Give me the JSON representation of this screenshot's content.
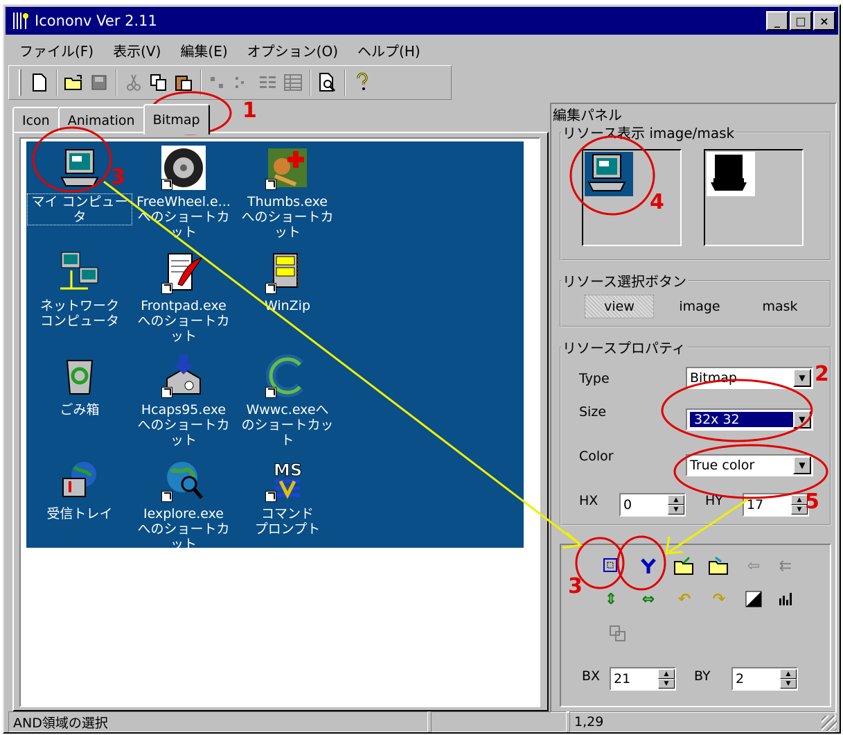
{
  "window": {
    "title": "Icononv Ver 2.11",
    "min": "_",
    "max": "□",
    "close": "×"
  },
  "menu": [
    "ファイル(F)",
    "表示(V)",
    "編集(E)",
    "オプション(O)",
    "ヘルプ(H)"
  ],
  "toolbar": {
    "icons": [
      "new-file-icon",
      "open-folder-icon",
      "save-icon",
      "cut-icon",
      "copy-icon",
      "paste-icon",
      "large-icons-icon",
      "small-icons-icon",
      "list-icon",
      "details-icon",
      "print-preview-icon",
      "help-icon"
    ]
  },
  "tabs": [
    "Icon",
    "Animation",
    "Bitmap"
  ],
  "desktop_icons": [
    {
      "label": "マイ コンピュータ",
      "icon": "my-computer-icon",
      "shortcut": false
    },
    {
      "label": "FreeWheel.e...\nへのショートカット",
      "icon": "wheel-icon",
      "shortcut": true
    },
    {
      "label": "Thumbs.exe\nへのショートカット",
      "icon": "thumbs-icon",
      "shortcut": true
    },
    {
      "label": "ネットワーク\nコンピュータ",
      "icon": "network-icon",
      "shortcut": false
    },
    {
      "label": "Frontpad.exe\nへのショートカット",
      "icon": "frontpad-icon",
      "shortcut": true
    },
    {
      "label": "WinZip",
      "icon": "winzip-icon",
      "shortcut": true
    },
    {
      "label": "ごみ箱",
      "icon": "recycle-bin-icon",
      "shortcut": false
    },
    {
      "label": "Hcaps95.exe\nへのショートカット",
      "icon": "hcaps-icon",
      "shortcut": true
    },
    {
      "label": "Wwwc.exeへ\nのショートカット",
      "icon": "wwwc-icon",
      "shortcut": true
    },
    {
      "label": "受信トレイ",
      "icon": "inbox-icon",
      "shortcut": false
    },
    {
      "label": "Iexplore.exe\nへのショートカット",
      "icon": "iexplore-icon",
      "shortcut": true
    },
    {
      "label": "コマンド\nプロンプト",
      "icon": "msdos-icon",
      "shortcut": true
    }
  ],
  "panel": {
    "title": "編集パネル",
    "resource_view": {
      "legend": "リソース表示 image/mask"
    },
    "select_buttons": {
      "legend": "リソース選択ボタン",
      "view": "view",
      "image": "image",
      "mask": "mask"
    },
    "properties": {
      "legend": "リソースプロパティ",
      "type_label": "Type",
      "type_value": "Bitmap",
      "size_label": "Size",
      "size_value": "32x 32",
      "color_label": "Color",
      "color_value": "True color",
      "hx_label": "HX",
      "hx_value": "0",
      "hy_label": "HY",
      "hy_value": "17"
    },
    "tools": {
      "bx_label": "BX",
      "bx_value": "21",
      "by_label": "BY",
      "by_value": "2"
    }
  },
  "status": {
    "message": "AND領域の選択",
    "middle": "",
    "coords": "1,29"
  },
  "annotations": [
    "1",
    "2",
    "3",
    "3",
    "4",
    "5"
  ],
  "colors": {
    "titlebar": "#000080",
    "desktop": "#0a4f87",
    "annotation_red": "#e00000",
    "annotation_yellow": "#f0f000",
    "face": "#c0c0c0"
  }
}
